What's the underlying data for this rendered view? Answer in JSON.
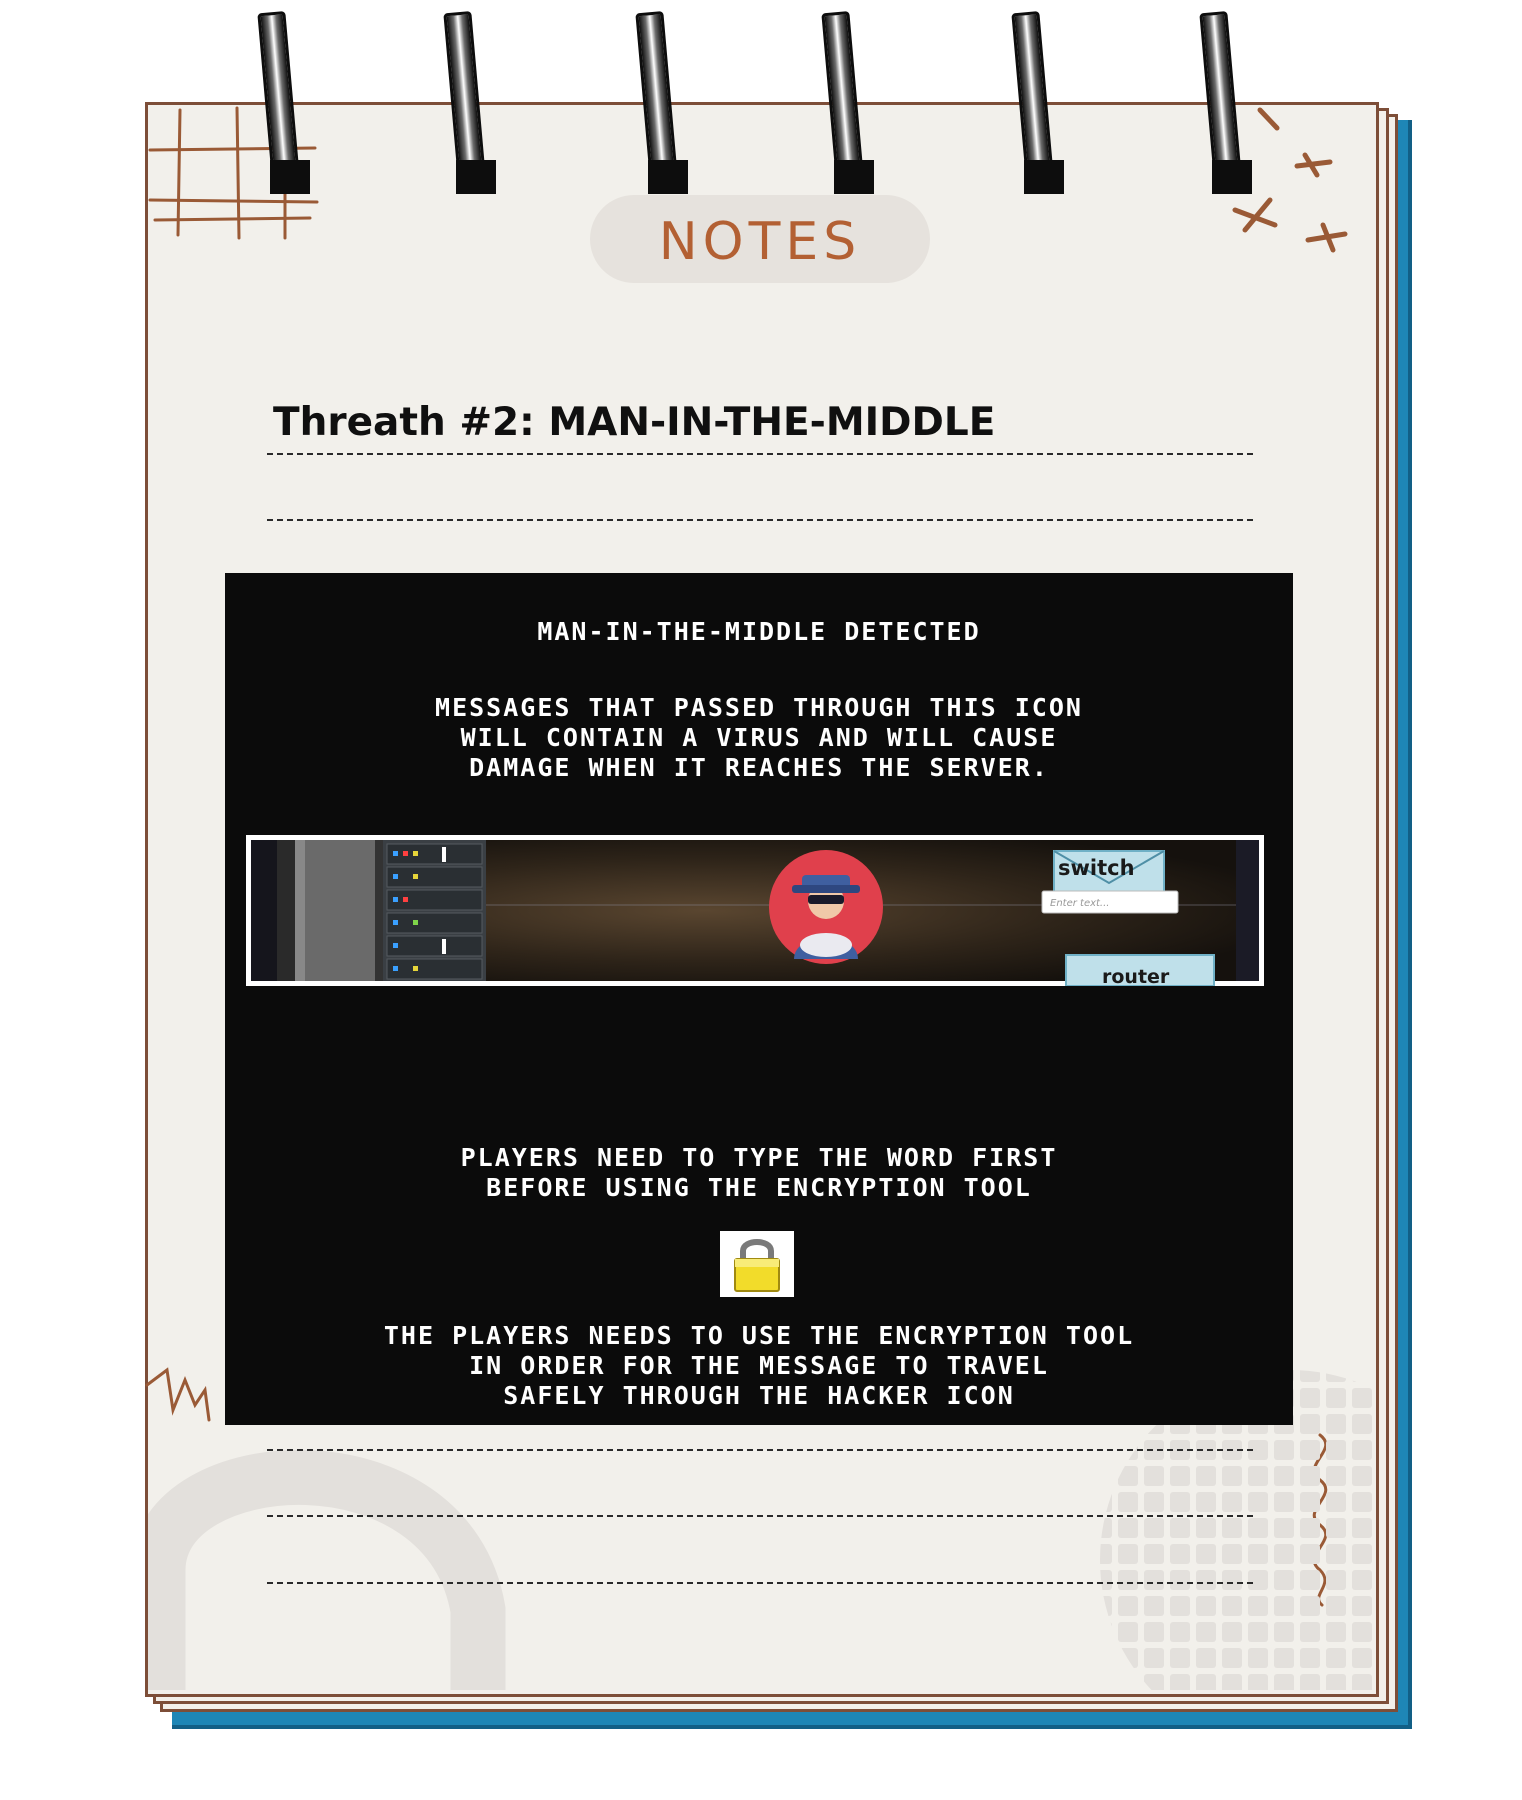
{
  "notebook": {
    "title": "NOTES",
    "heading": "Threath #2: MAN-IN-THE-MIDDLE"
  },
  "panel": {
    "detected": "Man-in-the-middle detected",
    "description": [
      "Messages that passed through this icon",
      "will contain a virus and will cause",
      "damage when it reaches the server."
    ],
    "instruction": [
      "Players need to type the word first",
      "before using the encryption tool"
    ],
    "outcome": [
      "The players needs to use the encryption tool",
      "in order for the message to travel",
      "safely through the hacker icon"
    ]
  },
  "game_screenshot": {
    "switch_label": "switch",
    "input_placeholder": "Enter text...",
    "router_label": "router"
  },
  "colors": {
    "accent_brown": "#b36033",
    "binder_blue": "#1e86b6",
    "panel_black": "#0b0b0b",
    "hacker_red": "#e0404c"
  }
}
